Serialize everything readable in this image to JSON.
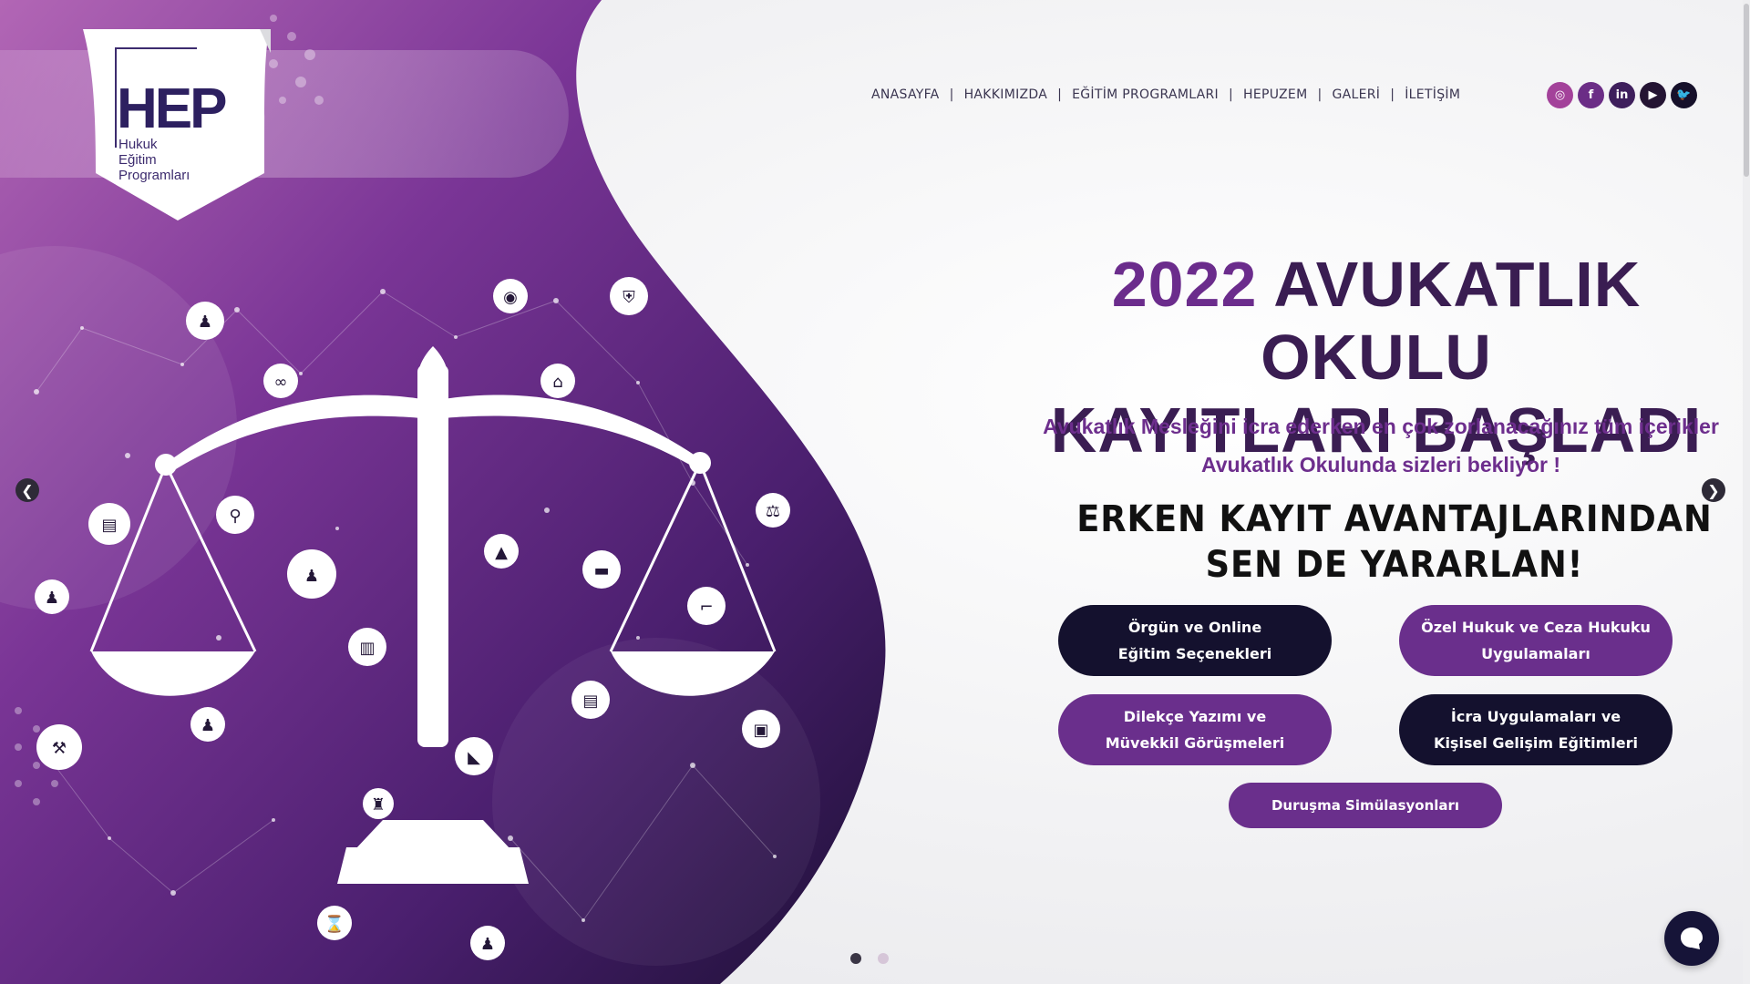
{
  "logo": {
    "mark": "HEP",
    "line1": "Hukuk",
    "line2": "Eğitim",
    "line3": "Programları"
  },
  "nav": {
    "items": [
      "ANASAYFA",
      "HAKKIMIZDA",
      "EĞİTİM PROGRAMLARI",
      "HEPUZEM",
      "GALERİ",
      "İLETİŞİM"
    ],
    "separator": "|"
  },
  "social": {
    "icons": [
      "instagram-icon",
      "facebook-icon",
      "linkedin-icon",
      "youtube-icon",
      "twitter-icon"
    ],
    "glyphs": [
      "◎",
      "f",
      "in",
      "▶",
      "🐦"
    ]
  },
  "hero": {
    "title_year": "2022",
    "title_line1_rest": "AVUKATLIK OKULU",
    "title_line2": "KAYITLARI BAŞLADI",
    "subtitle_line1": "Avukatlık Mesleğini icra ederken en çok zorlanacağınız tüm içerikler",
    "subtitle_line2": "Avukatlık Okulunda sizleri bekliyor !",
    "promo_line1": "ERKEN KAYIT AVANTAJLARINDAN",
    "promo_line2": "SEN DE YARARLAN!"
  },
  "buttons": {
    "b1_line1": "Örgün ve Online",
    "b1_line2": "Eğitim Seçenekleri",
    "b2_line1": "Özel Hukuk ve Ceza Hukuku",
    "b2_line2": "Uygulamaları",
    "b3_line1": "Dilekçe Yazımı ve",
    "b3_line2": "Müvekkil Görüşmeleri",
    "b4_line1": "İcra Uygulamaları ve",
    "b4_line2": "Kişisel Gelişim Eğitimleri",
    "b5": "Duruşma Simülasyonları"
  },
  "slider": {
    "prev": "❮",
    "next": "❯",
    "slide_count": 2,
    "active_slide": 1
  },
  "colors": {
    "brand_purple": "#6a2f8c",
    "brand_dark": "#14112e",
    "title_dark": "#3a1d52"
  }
}
